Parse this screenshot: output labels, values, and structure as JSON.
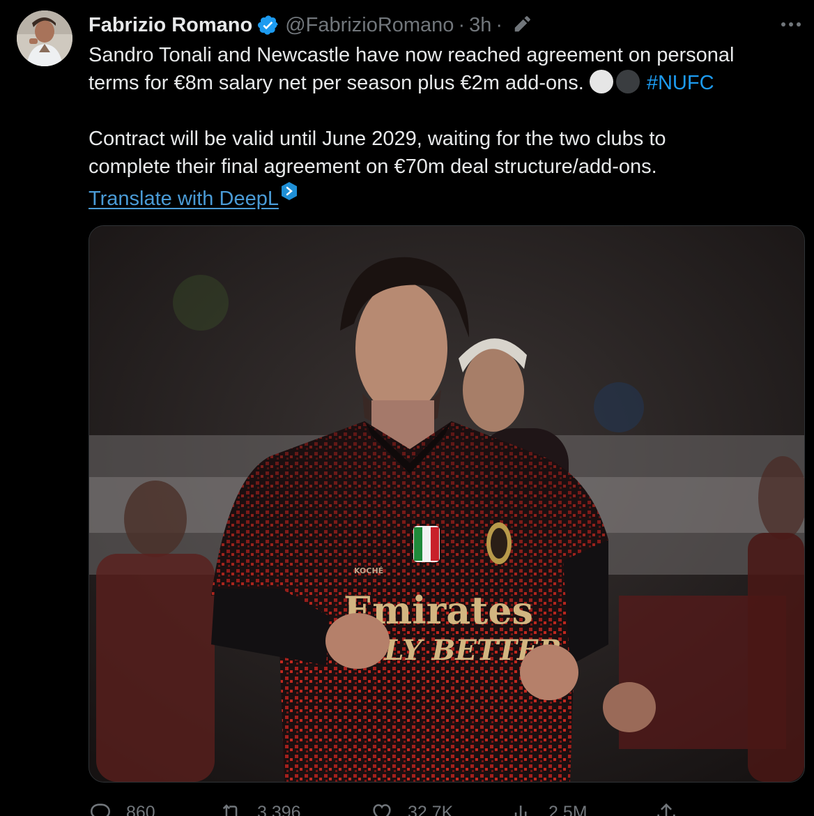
{
  "author": {
    "display_name": "Fabrizio Romano",
    "handle": "@FabrizioRomano",
    "separator": "·",
    "time": "3h",
    "separator2": "·"
  },
  "tweet": {
    "line1": "Sandro Tonali and Newcastle have now reached agreement on personal",
    "line2": "terms for €8m salary net per season plus €2m add-ons.",
    "hashtag": "#NUFC",
    "line3": "Contract will be valid until June 2029, waiting for the two clubs to",
    "line4": "complete their final agreement on €70m deal structure/add-ons.",
    "translate_label": "Translate with DeepL"
  },
  "media": {
    "jersey_sponsor_top": "Emirates",
    "jersey_sponsor_bottom": "FLY BETTER",
    "jersey_maker": "KOCHÉ"
  },
  "actions": {
    "replies": "860",
    "retweets": "3,396",
    "likes": "32.7K",
    "views": "2.5M"
  },
  "colors": {
    "background": "#000000",
    "text": "#e7e9ea",
    "muted": "#71767b",
    "accent": "#1d9bf0",
    "link": "#4a9bd6"
  },
  "icons": {
    "verified": "verified-badge-icon",
    "edit": "edit-pencil-icon",
    "more": "more-dots-icon",
    "deepl": "deepl-icon",
    "reply": "reply-icon",
    "retweet": "retweet-icon",
    "like": "like-icon",
    "views": "views-icon",
    "share": "share-icon"
  }
}
